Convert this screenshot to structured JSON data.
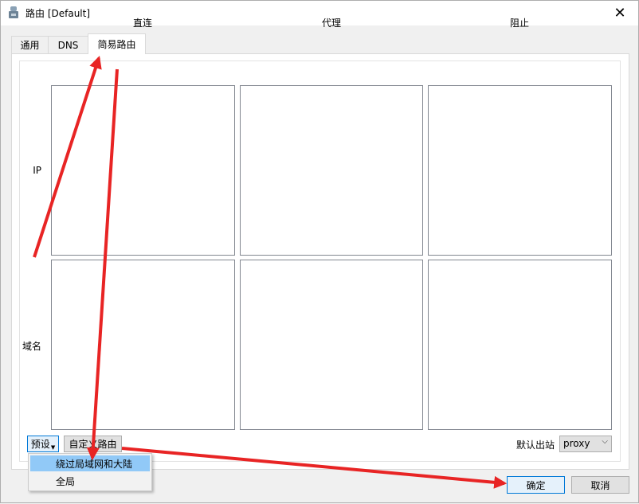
{
  "window": {
    "title": "路由 [Default]",
    "close_glyph": "✕"
  },
  "tabs": [
    {
      "label": "通用",
      "active": false
    },
    {
      "label": "DNS",
      "active": false
    },
    {
      "label": "简易路由",
      "active": true
    }
  ],
  "grid": {
    "columns": [
      "直连",
      "代理",
      "阻止"
    ],
    "rows": [
      "IP",
      "域名"
    ]
  },
  "footer": {
    "preset_label": "预设",
    "custom_label": "自定义路由",
    "default_outbound_label": "默认出站",
    "default_outbound_value": "proxy"
  },
  "preset_menu": {
    "items": [
      {
        "label": "绕过局域网和大陆",
        "highlighted": true
      },
      {
        "label": "全局",
        "highlighted": false
      }
    ]
  },
  "dialog_buttons": {
    "ok": "确定",
    "cancel": "取消"
  },
  "annotation_color": "#e82424"
}
